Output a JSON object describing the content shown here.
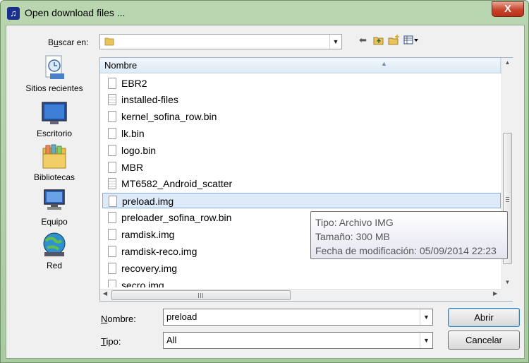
{
  "window": {
    "title": "Open download files ...",
    "close_glyph": "X"
  },
  "lookin": {
    "label_prefix": "B",
    "label_accel": "u",
    "label_suffix": "scar en:",
    "folder_icon": "folder-icon"
  },
  "toolbar": {
    "back_icon": "back-arrow-icon",
    "up_icon": "up-folder-icon",
    "new_folder_icon": "new-folder-icon",
    "views_icon": "view-menu-icon"
  },
  "places": [
    {
      "label": "Sitios recientes",
      "icon": "recent-places-icon"
    },
    {
      "label": "Escritorio",
      "icon": "desktop-icon"
    },
    {
      "label": "Bibliotecas",
      "icon": "libraries-icon"
    },
    {
      "label": "Equipo",
      "icon": "computer-icon"
    },
    {
      "label": "Red",
      "icon": "network-icon"
    }
  ],
  "filelist": {
    "column_name": "Nombre",
    "files": [
      {
        "name": "EBR2",
        "type": "file"
      },
      {
        "name": "installed-files",
        "type": "text"
      },
      {
        "name": "kernel_sofina_row.bin",
        "type": "file"
      },
      {
        "name": "lk.bin",
        "type": "file"
      },
      {
        "name": "logo.bin",
        "type": "file"
      },
      {
        "name": "MBR",
        "type": "file"
      },
      {
        "name": "MT6582_Android_scatter",
        "type": "text"
      },
      {
        "name": "preload.img",
        "type": "file",
        "selected": true
      },
      {
        "name": "preloader_sofina_row.bin",
        "type": "file"
      },
      {
        "name": "ramdisk.img",
        "type": "file"
      },
      {
        "name": "ramdisk-reco.img",
        "type": "file"
      },
      {
        "name": "recovery.img",
        "type": "file"
      },
      {
        "name": "secro.img",
        "type": "file"
      }
    ]
  },
  "tooltip": {
    "type": "Tipo: Archivo IMG",
    "size": "Tamaño: 300 MB",
    "modified": "Fecha de modificación: 05/09/2014 22:23"
  },
  "name_field": {
    "label_accel": "N",
    "label_rest": "ombre:",
    "value": "preload"
  },
  "type_field": {
    "label_accel": "T",
    "label_rest": "ipo:",
    "value": "All"
  },
  "buttons": {
    "open": "Abrir",
    "cancel": "Cancelar"
  }
}
